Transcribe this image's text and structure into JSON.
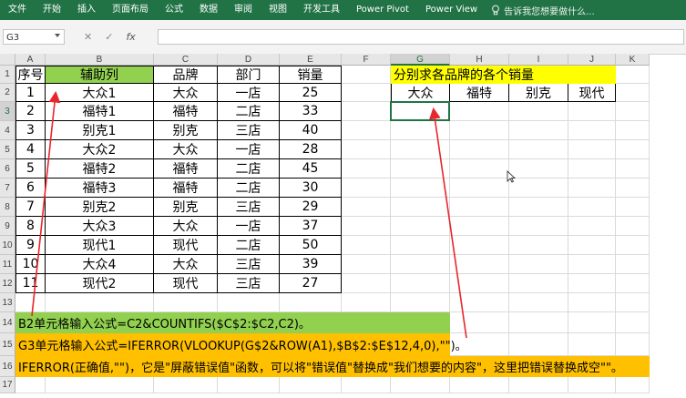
{
  "ribbon": {
    "tabs": [
      "文件",
      "开始",
      "插入",
      "页面布局",
      "公式",
      "数据",
      "审阅",
      "视图",
      "开发工具",
      "Power Pivot",
      "Power View"
    ],
    "tell_me": "告诉我您想要做什么..."
  },
  "formula_bar": {
    "name_box": "G3",
    "cancel_icon": "✕",
    "enter_icon": "✓",
    "fx_label": "fx",
    "content": ""
  },
  "sheet": {
    "columns": [
      "A",
      "B",
      "C",
      "D",
      "E",
      "F",
      "G",
      "H",
      "I",
      "J",
      "K"
    ],
    "rows": [
      "1",
      "2",
      "3",
      "4",
      "5",
      "6",
      "7",
      "8",
      "9",
      "10",
      "11",
      "12",
      "13",
      "14",
      "15",
      "16",
      "17"
    ],
    "headers": [
      "序号",
      "辅助列",
      "品牌",
      "部门",
      "销量"
    ],
    "data": [
      [
        "1",
        "大众1",
        "大众",
        "一店",
        "25"
      ],
      [
        "2",
        "福特1",
        "福特",
        "二店",
        "33"
      ],
      [
        "3",
        "别克1",
        "别克",
        "三店",
        "40"
      ],
      [
        "4",
        "大众2",
        "大众",
        "一店",
        "28"
      ],
      [
        "5",
        "福特2",
        "福特",
        "二店",
        "45"
      ],
      [
        "6",
        "福特3",
        "福特",
        "二店",
        "30"
      ],
      [
        "7",
        "别克2",
        "别克",
        "三店",
        "29"
      ],
      [
        "8",
        "大众3",
        "大众",
        "一店",
        "37"
      ],
      [
        "9",
        "现代1",
        "现代",
        "二店",
        "50"
      ],
      [
        "10",
        "大众4",
        "大众",
        "三店",
        "39"
      ],
      [
        "11",
        "现代2",
        "现代",
        "三店",
        "27"
      ]
    ],
    "right_title": "分别求各品牌的各个销量",
    "brands": [
      "大众",
      "福特",
      "别克",
      "现代"
    ]
  },
  "notes": {
    "b2": "B2单元格输入公式=C2&COUNTIFS($C$2:$C2,C2)。",
    "g3": "G3单元格输入公式=IFERROR(VLOOKUP(G$2&ROW(A1),$B$2:$E$12,4,0),\"\")。",
    "iferror": "IFERROR(正确值,\"\")，它是\"屏蔽错误值\"函数，可以将\"错误值\"替换成\"我们想要的内容\"，这里把错误替换成空\"\"。"
  },
  "colors": {
    "ribbon": "#217346",
    "green": "#92d050",
    "yellow": "#ffff00",
    "orange": "#ffc000",
    "arrow": "#e8262d"
  }
}
